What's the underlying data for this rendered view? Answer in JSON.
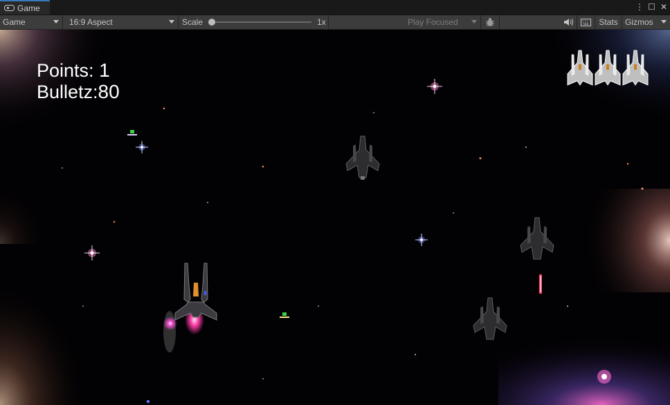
{
  "tab": {
    "title": "Game",
    "icon": "gamepad-icon"
  },
  "window_controls": {
    "menu": "⋮",
    "maximize": "☐",
    "close": "✕"
  },
  "toolbar": {
    "display": "Game",
    "aspect": "16:9 Aspect",
    "scale_label": "Scale",
    "scale_value": "1x",
    "play_mode": "Play Focused",
    "stats": "Stats",
    "gizmos": "Gizmos"
  },
  "hud": {
    "points_label": "Points:",
    "points_value": "1",
    "bullets_label": "Bulletz:",
    "bullets_value": "80",
    "lives": 3
  },
  "colors": {
    "accent": "#3a79bb",
    "toolbar": "#3c3c3c",
    "space": "#020103"
  }
}
